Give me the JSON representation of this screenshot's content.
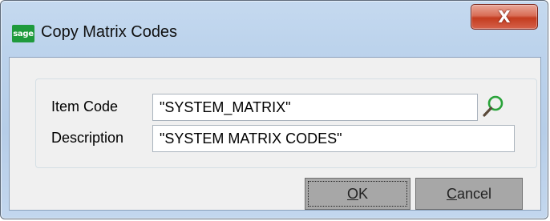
{
  "window": {
    "title": "Copy Matrix Codes",
    "app_icon_text": "sage",
    "close_glyph": "X"
  },
  "form": {
    "item_code_label": "Item Code",
    "item_code_value": "\"SYSTEM_MATRIX\"",
    "description_label": "Description",
    "description_value": "\"SYSTEM MATRIX CODES\""
  },
  "buttons": {
    "ok_mnemonic": "O",
    "ok_rest": "K",
    "cancel_mnemonic": "C",
    "cancel_rest": "ancel"
  },
  "icons": {
    "app": "sage-logo-icon",
    "lookup": "magnifier-icon",
    "close": "close-icon"
  },
  "colors": {
    "brand": "#1f9a3c",
    "close_button": "#c43c1f",
    "lookup_icon": "#2aa33a"
  }
}
